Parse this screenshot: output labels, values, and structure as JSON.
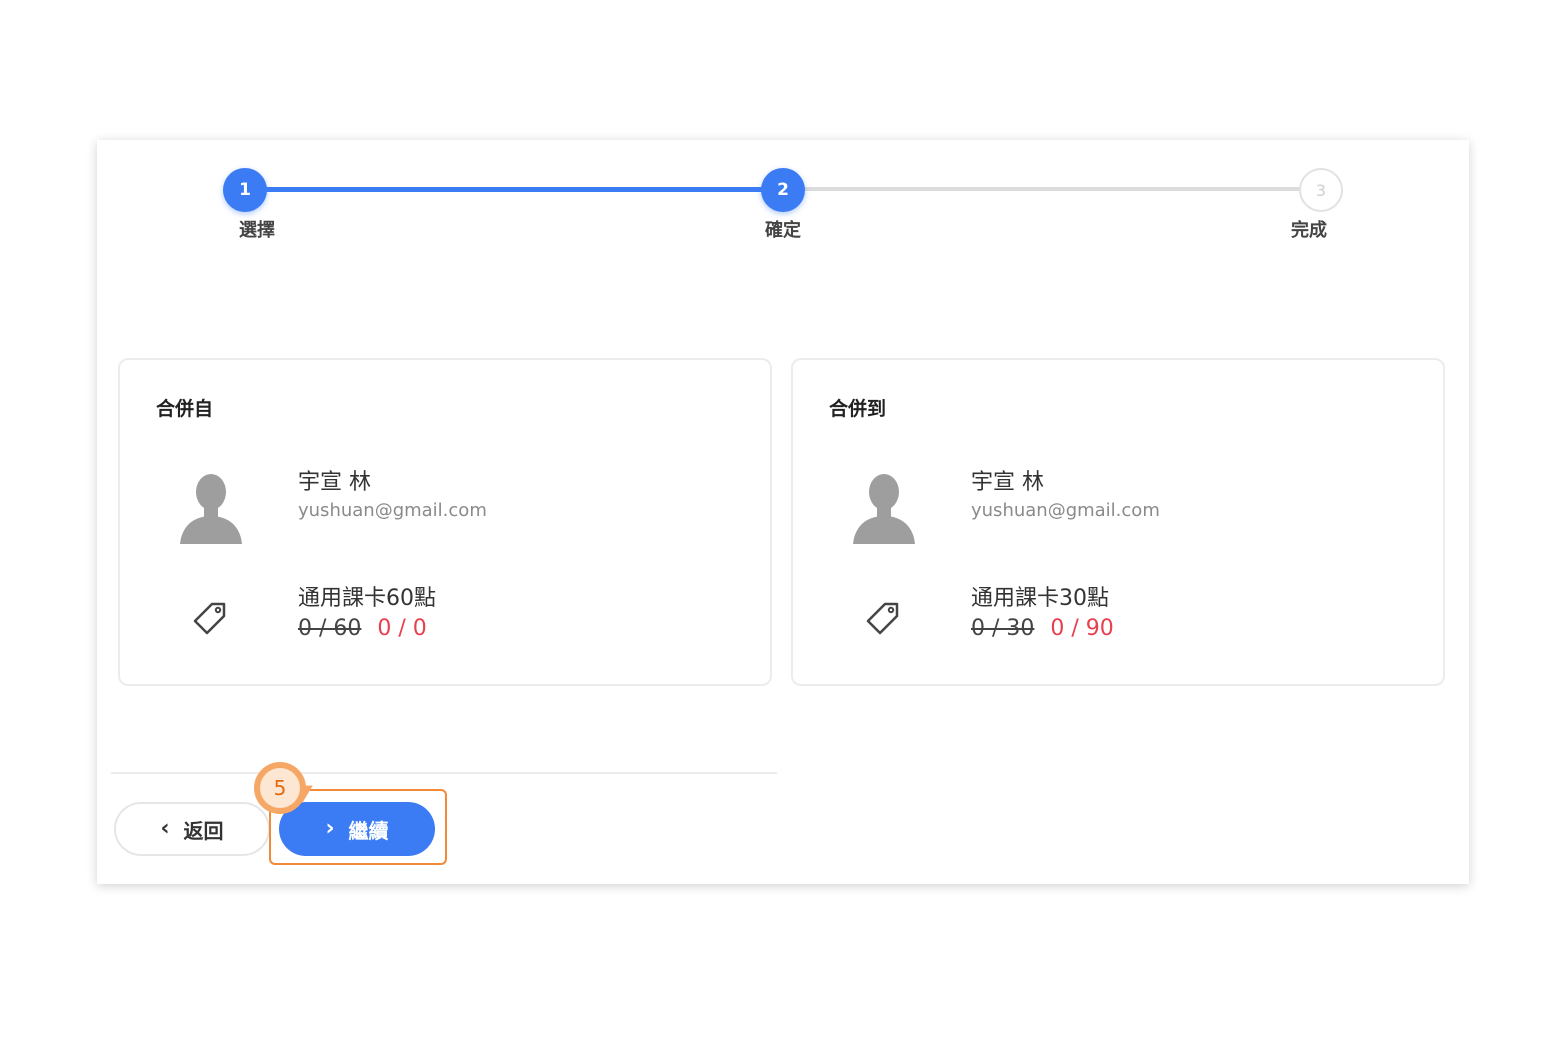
{
  "stepper": {
    "steps": [
      {
        "number": "1",
        "label": "選擇",
        "state": "done"
      },
      {
        "number": "2",
        "label": "確定",
        "state": "active"
      },
      {
        "number": "3",
        "label": "完成",
        "state": "pending"
      }
    ]
  },
  "merge_from": {
    "title": "合併自",
    "user_name": "宇宣 林",
    "user_email": "yushuan@gmail.com",
    "card_name": "通用課卡60點",
    "points_old": "0 / 60",
    "points_new": "0 / 0"
  },
  "merge_to": {
    "title": "合併到",
    "user_name": "宇宣 林",
    "user_email": "yushuan@gmail.com",
    "card_name": "通用課卡30點",
    "points_old": "0 / 30",
    "points_new": "0 / 90"
  },
  "footer": {
    "back_label": "返回",
    "continue_label": "繼續"
  },
  "annotation": {
    "callout_number": "5"
  },
  "colors": {
    "accent": "#3b7cf5",
    "highlight": "#f28a3a",
    "points_new": "#e8404f"
  }
}
